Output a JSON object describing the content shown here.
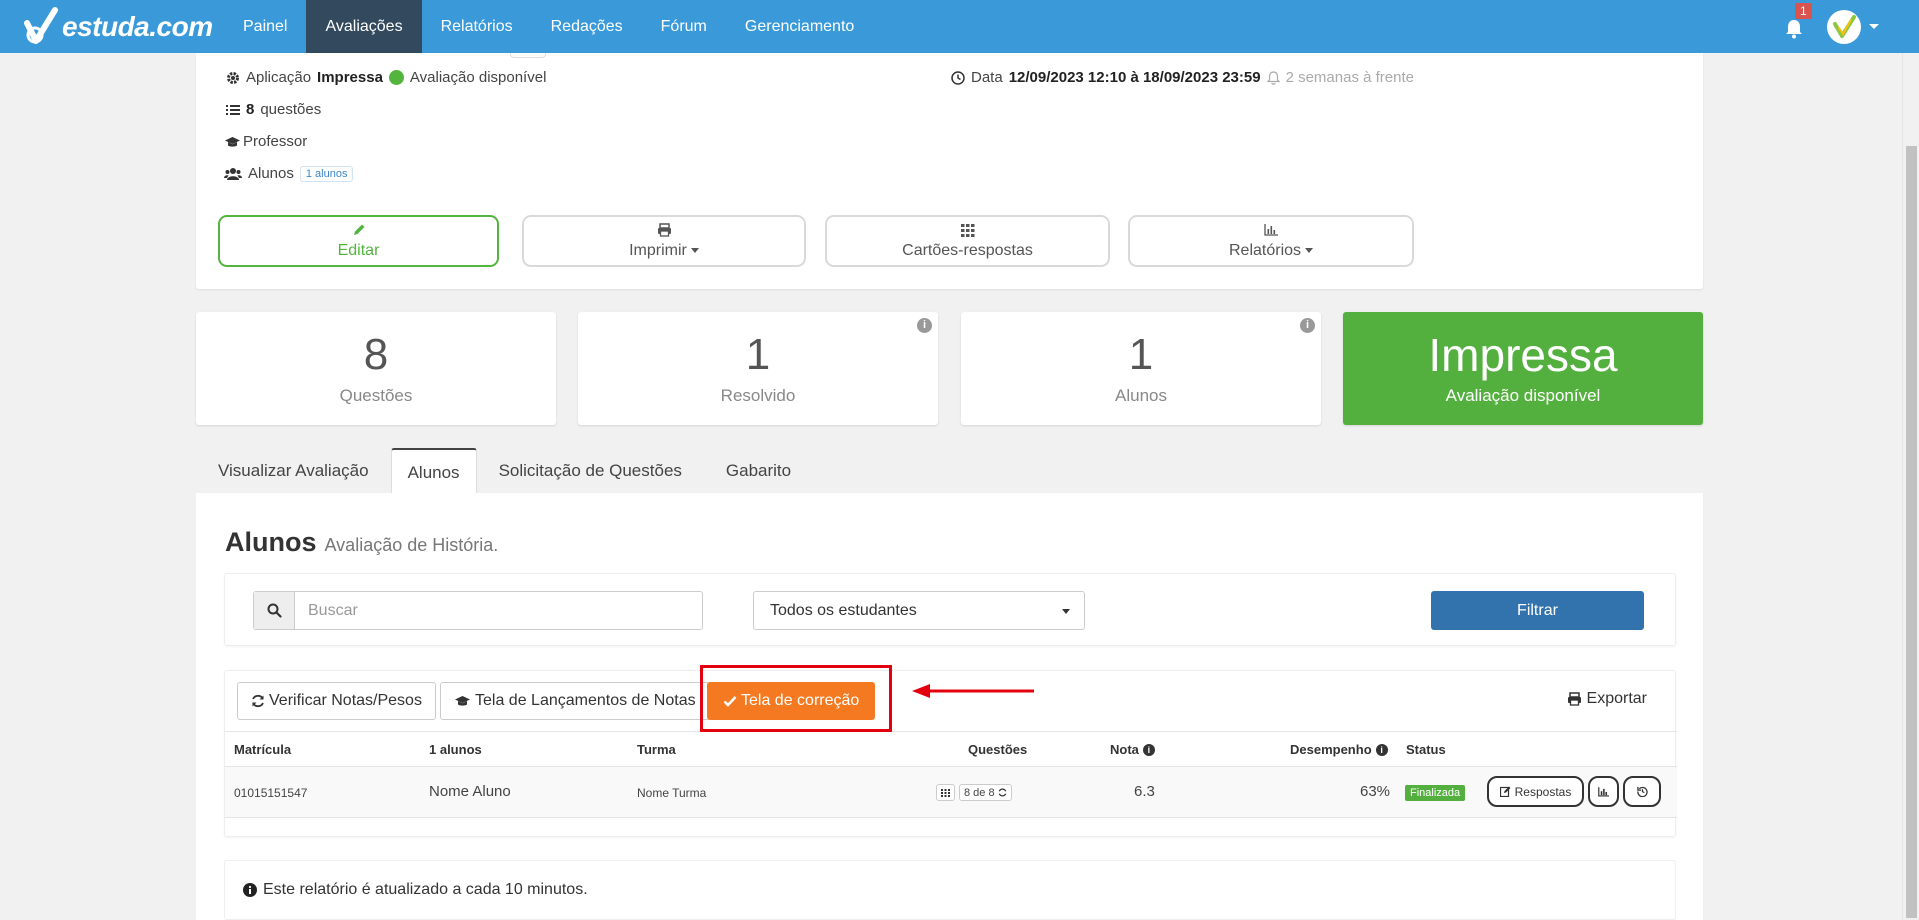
{
  "brand": {
    "name": "estuda.com"
  },
  "nav": {
    "items": [
      "Painel",
      "Avaliações",
      "Relatórios",
      "Redações",
      "Fórum",
      "Gerenciamento"
    ],
    "active": "Avaliações"
  },
  "notifications": {
    "count": "1"
  },
  "details": {
    "aplicacao_label": "Aplicação",
    "aplicacao_value": "Impressa",
    "status": "Avaliação disponível",
    "questoes_count": "8",
    "questoes_label": "questões",
    "professor": "Professor",
    "alunos_label": "Alunos",
    "alunos_tag": "1 alunos",
    "data_label": "Data",
    "data_value": "12/09/2023 12:10 à 18/09/2023 23:59",
    "relative": "2 semanas à frente"
  },
  "actions": {
    "editar": "Editar",
    "imprimir": "Imprimir",
    "cartoes": "Cartões-respostas",
    "relatorios": "Relatórios"
  },
  "stats": [
    {
      "value": "8",
      "label": "Questões"
    },
    {
      "value": "1",
      "label": "Resolvido"
    },
    {
      "value": "1",
      "label": "Alunos"
    },
    {
      "value": "Impressa",
      "label": "Avaliação disponível"
    }
  ],
  "tabs": [
    "Visualizar Avaliação",
    "Alunos",
    "Solicitação de Questões",
    "Gabarito"
  ],
  "active_tab": "Alunos",
  "section": {
    "title": "Alunos",
    "subtitle": "Avaliação de História."
  },
  "filters": {
    "search_placeholder": "Buscar",
    "select_value": "Todos os estudantes",
    "filter_button": "Filtrar"
  },
  "toolbar": {
    "verificar": "Verificar Notas/Pesos",
    "lancamentos": "Tela de Lançamentos de Notas",
    "correcao": "Tela de correção",
    "exportar": "Exportar"
  },
  "table": {
    "headers": {
      "matricula": "Matrícula",
      "alunos": "1 alunos",
      "turma": "Turma",
      "questoes": "Questões",
      "nota": "Nota",
      "desempenho": "Desempenho",
      "status": "Status"
    },
    "rows": [
      {
        "matricula": "01015151547",
        "nome": "Nome Aluno",
        "turma": "Nome Turma",
        "questoes": "8 de 8",
        "nota": "6.3",
        "desempenho": "63%",
        "status": "Finalizada",
        "respostas": "Respostas"
      }
    ]
  },
  "notice": "Este relatório é atualizado a cada 10 minutos.",
  "colors": {
    "nav_bg": "#3a9ad9",
    "nav_active": "#32495e",
    "green": "#54b03e",
    "orange": "#f47920",
    "filter_blue": "#3273ad",
    "annotation_red": "#e3000f"
  }
}
